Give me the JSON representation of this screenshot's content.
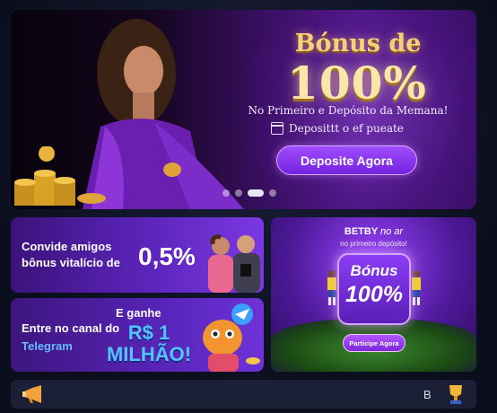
{
  "hero": {
    "bonus_title": "Bónus de",
    "bonus_percent": "100%",
    "subtitle": "No Primeiro e Depósito da Memana!",
    "deposit_note": "Deposittt o ef pueate",
    "cta_label": "Deposite Agora",
    "carousel_total": 4,
    "carousel_active": 2
  },
  "invite_card": {
    "text": "Convide amigos bônus vitalício de",
    "percent": "0,5%"
  },
  "telegram_card": {
    "text_prefix": "Entre no canal do",
    "text_highlight": "Telegram",
    "ganhe": "E ganhe",
    "amount_line1": "R$ 1",
    "amount_line2": "MILHÃO!"
  },
  "betby_card": {
    "brand": "BETBY",
    "brand_suffix": "no ar",
    "subtitle": "no primeiro depósito!",
    "bonus_word": "Bónus",
    "bonus_percent": "100%",
    "cta_label": "Participe Agora"
  },
  "bottom_bar": {
    "marquee_text": "B"
  },
  "colors": {
    "hero_accent": "#7423e0",
    "gold": "#f6d07a",
    "telegram_blue": "#6bb9ff"
  }
}
